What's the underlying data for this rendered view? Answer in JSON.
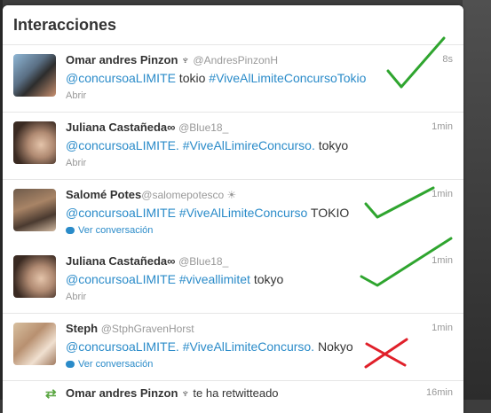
{
  "panel": {
    "title": "Interacciones"
  },
  "items": [
    {
      "name": "Omar andres Pinzon ♆",
      "handle": "@AndresPinzonH",
      "time": "8s",
      "text": [
        {
          "t": "@concursoaLIMITE",
          "link": true
        },
        {
          "t": " tokio ",
          "link": false
        },
        {
          "t": "#ViveAlLimiteConcursoTokio",
          "link": true
        }
      ],
      "action": "Abrir",
      "action_type": "open"
    },
    {
      "name": "Juliana Castañeda∞",
      "handle": "@Blue18_",
      "time": "1min",
      "text": [
        {
          "t": "@concursoaLIMITE.",
          "link": true
        },
        {
          "t": " ",
          "link": false
        },
        {
          "t": "#ViveAlLimireConcurso.",
          "link": true
        },
        {
          "t": " tokyo",
          "link": false
        }
      ],
      "action": "Abrir",
      "action_type": "open"
    },
    {
      "name": "Salomé Potes",
      "handle": "@salomepotesco ☀",
      "time": "1min",
      "text": [
        {
          "t": "@concursoaLIMITE",
          "link": true
        },
        {
          "t": " ",
          "link": false
        },
        {
          "t": "#ViveAlLimiteConcurso",
          "link": true
        },
        {
          "t": " TOKIO",
          "link": false
        }
      ],
      "action": "Ver conversación",
      "action_type": "conversation"
    },
    {
      "name": "Juliana Castañeda∞",
      "handle": "@Blue18_",
      "time": "1min",
      "text": [
        {
          "t": "@concursoaLIMITE",
          "link": true
        },
        {
          "t": " ",
          "link": false
        },
        {
          "t": "#viveallimitet",
          "link": true
        },
        {
          "t": " tokyo",
          "link": false
        }
      ],
      "action": "Abrir",
      "action_type": "open"
    },
    {
      "name": "Steph",
      "handle": "@StphGravenHorst",
      "time": "1min",
      "text": [
        {
          "t": "@concursoaLIMITE.",
          "link": true
        },
        {
          "t": " ",
          "link": false
        },
        {
          "t": "#ViveAlLimiteConcurso.",
          "link": true
        },
        {
          "t": " Nokyo",
          "link": false
        }
      ],
      "action": "Ver conversación",
      "action_type": "conversation"
    }
  ],
  "retweet": {
    "name": "Omar andres Pinzon ♆",
    "text": "te ha retwitteado",
    "time": "16min"
  },
  "colors": {
    "link": "#2a8bc9",
    "check": "#2fa52f",
    "cross": "#e0202a",
    "retweet": "#5aa642"
  }
}
